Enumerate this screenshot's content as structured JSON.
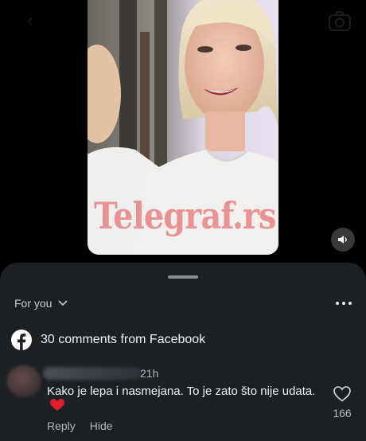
{
  "video": {
    "watermark": "Telegraf.rs"
  },
  "sheet": {
    "feed_label": "For you",
    "comments_heading": "30 comments from Facebook"
  },
  "comment": {
    "time": "21h",
    "text": "Kako je lepa i nasmejana. To je zato što nije udata.",
    "reply_label": "Reply",
    "hide_label": "Hide",
    "like_count": "166"
  },
  "colors": {
    "sheet_bg": "#1c2024",
    "facebook_logo": "#ffffff",
    "heart_emoji": "#e11d2e"
  },
  "icons": [
    "back-arrow-icon",
    "camera-icon",
    "speaker-icon",
    "chevron-down-icon",
    "more-icon",
    "facebook-logo-icon",
    "heart-emoji-icon",
    "heart-outline-icon"
  ]
}
